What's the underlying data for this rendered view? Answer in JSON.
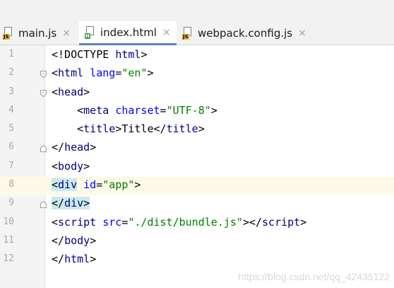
{
  "tabs": [
    {
      "label": "main.js",
      "type": "JS",
      "active": false
    },
    {
      "label": "index.html",
      "type": "H",
      "active": true
    },
    {
      "label": "webpack.config.js",
      "type": "JS",
      "active": false
    }
  ],
  "tab_close": "×",
  "lines": [
    {
      "num": "1",
      "indent": "",
      "parts": [
        [
          "tx",
          "<!DOCTYPE "
        ],
        [
          "tag",
          "html"
        ],
        [
          "tx",
          ">"
        ]
      ]
    },
    {
      "num": "2",
      "indent": "",
      "parts": [
        [
          "tx",
          "<"
        ],
        [
          "tag",
          "html"
        ],
        [
          "tx",
          " "
        ],
        [
          "attr",
          "lang"
        ],
        [
          "tx",
          "="
        ],
        [
          "str",
          "\"en\""
        ],
        [
          "tx",
          ">"
        ]
      ]
    },
    {
      "num": "3",
      "indent": "",
      "parts": [
        [
          "tx",
          "<"
        ],
        [
          "tag",
          "head"
        ],
        [
          "tx",
          ">"
        ]
      ]
    },
    {
      "num": "4",
      "indent": "    ",
      "parts": [
        [
          "tx",
          "<"
        ],
        [
          "tag",
          "meta"
        ],
        [
          "tx",
          " "
        ],
        [
          "attr",
          "charset"
        ],
        [
          "tx",
          "="
        ],
        [
          "str",
          "\"UTF-8\""
        ],
        [
          "tx",
          ">"
        ]
      ]
    },
    {
      "num": "5",
      "indent": "    ",
      "parts": [
        [
          "tx",
          "<"
        ],
        [
          "tag",
          "title"
        ],
        [
          "tx",
          ">Title</"
        ],
        [
          "tag",
          "title"
        ],
        [
          "tx",
          ">"
        ]
      ]
    },
    {
      "num": "6",
      "indent": "",
      "parts": [
        [
          "tx",
          "</"
        ],
        [
          "tag",
          "head"
        ],
        [
          "tx",
          ">"
        ]
      ]
    },
    {
      "num": "7",
      "indent": "",
      "parts": [
        [
          "tx",
          "<"
        ],
        [
          "tag",
          "body"
        ],
        [
          "tx",
          ">"
        ]
      ]
    },
    {
      "num": "8",
      "indent": "",
      "parts": [
        [
          "tx hl",
          "<"
        ],
        [
          "tag hl",
          "div"
        ],
        [
          "tx",
          " "
        ],
        [
          "attr",
          "id"
        ],
        [
          "tx",
          "="
        ],
        [
          "str",
          "\"app\""
        ],
        [
          "tx",
          ">"
        ]
      ]
    },
    {
      "num": "9",
      "indent": "",
      "parts": [
        [
          "tx hl",
          "</"
        ],
        [
          "tag hl",
          "div"
        ],
        [
          "tx hl",
          ">"
        ]
      ]
    },
    {
      "num": "10",
      "indent": "",
      "parts": [
        [
          "tx",
          "<"
        ],
        [
          "tag",
          "script"
        ],
        [
          "tx",
          " "
        ],
        [
          "attr",
          "src"
        ],
        [
          "tx",
          "="
        ],
        [
          "str",
          "\"./dist/bundle.js\""
        ],
        [
          "tx",
          "></"
        ],
        [
          "tag",
          "script"
        ],
        [
          "tx",
          ">"
        ]
      ]
    },
    {
      "num": "11",
      "indent": "",
      "parts": [
        [
          "tx",
          "</"
        ],
        [
          "tag",
          "body"
        ],
        [
          "tx",
          ">"
        ]
      ]
    },
    {
      "num": "12",
      "indent": "",
      "parts": [
        [
          "tx",
          "</"
        ],
        [
          "tag",
          "html"
        ],
        [
          "tx",
          ">"
        ]
      ]
    }
  ],
  "current_line": "8",
  "fold_open_lines": [
    "2",
    "3"
  ],
  "fold_close_lines": [
    "6",
    "9"
  ],
  "watermark": "https://blog.csdn.net/qq_42435122",
  "colors": {
    "tag": "#000080",
    "attr": "#0000ff",
    "string": "#008000",
    "active_tab_underline": "#5b84c4"
  }
}
